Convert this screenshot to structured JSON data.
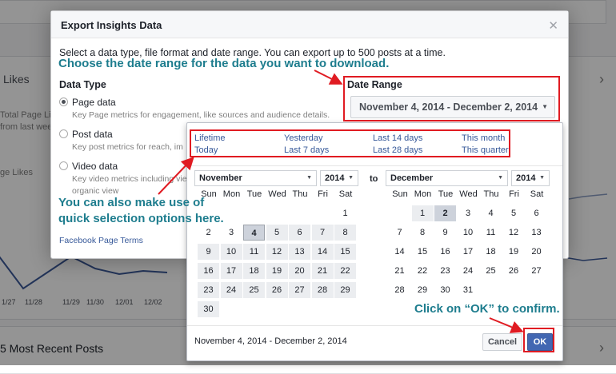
{
  "background": {
    "likes_heading": "Likes",
    "total_page_likes": "Total Page Lik",
    "from_last_week": "from last wee",
    "page_likes": "ge Likes",
    "axis_dates": [
      "1/27",
      "11/28",
      "11/29",
      "11/30",
      "12/01",
      "12/02"
    ],
    "recent_posts": "5 Most Recent Posts"
  },
  "dialog": {
    "title": "Export Insights Data",
    "close_icon": "close-icon",
    "intro": "Select a data type, file format and date range. You can export up to 500 posts at a time.",
    "data_type_heading": "Data Type",
    "options": [
      {
        "label": "Page data",
        "desc": "Key Page metrics for engagement, like sources and audience details.",
        "checked": true
      },
      {
        "label": "Post data",
        "desc": "Key post metrics for reach, im",
        "checked": false
      },
      {
        "label": "Video data",
        "desc": "Key video metrics including vie",
        "desc2": "organic view",
        "checked": false
      }
    ],
    "terms_link": "Facebook Page Terms",
    "date_range_heading": "Date Range",
    "date_range_value": "November 4, 2014 - December 2, 2014"
  },
  "picker": {
    "quick": [
      [
        "Lifetime",
        "Yesterday",
        "Last 14 days",
        "This month"
      ],
      [
        "Today",
        "Last 7 days",
        "Last 28 days",
        "This quarter"
      ]
    ],
    "to_label": "to",
    "left": {
      "month": "November",
      "year": "2014",
      "days": [
        "",
        "",
        "",
        "",
        "",
        "",
        "1",
        "2",
        "3",
        "4",
        "5",
        "6",
        "7",
        "8",
        "9",
        "10",
        "11",
        "12",
        "13",
        "14",
        "15",
        "16",
        "17",
        "18",
        "19",
        "20",
        "21",
        "22",
        "23",
        "24",
        "25",
        "26",
        "27",
        "28",
        "29",
        "30"
      ]
    },
    "right": {
      "month": "December",
      "year": "2014",
      "days": [
        "",
        "1",
        "2",
        "3",
        "4",
        "5",
        "6",
        "7",
        "8",
        "9",
        "10",
        "11",
        "12",
        "13",
        "14",
        "15",
        "16",
        "17",
        "18",
        "19",
        "20",
        "21",
        "22",
        "23",
        "24",
        "25",
        "26",
        "27",
        "28",
        "29",
        "30",
        "31"
      ]
    },
    "weekdays": [
      "Sun",
      "Mon",
      "Tue",
      "Wed",
      "Thu",
      "Fri",
      "Sat"
    ],
    "selected_range_text": "November 4, 2014 - December 2, 2014",
    "cancel_label": "Cancel",
    "ok_label": "OK"
  },
  "annotations": {
    "date_range_tip": "Choose the date range for the data you want to download.",
    "quick_tip_line1": "You can also make use of",
    "quick_tip_line2": "quick selection options here.",
    "ok_tip": "Click on “OK” to confirm.",
    "annotation_color": "#1e7d8e",
    "highlight_color": "#e01b22"
  },
  "colors": {
    "link": "#365899",
    "primary_button": "#4267b2"
  }
}
